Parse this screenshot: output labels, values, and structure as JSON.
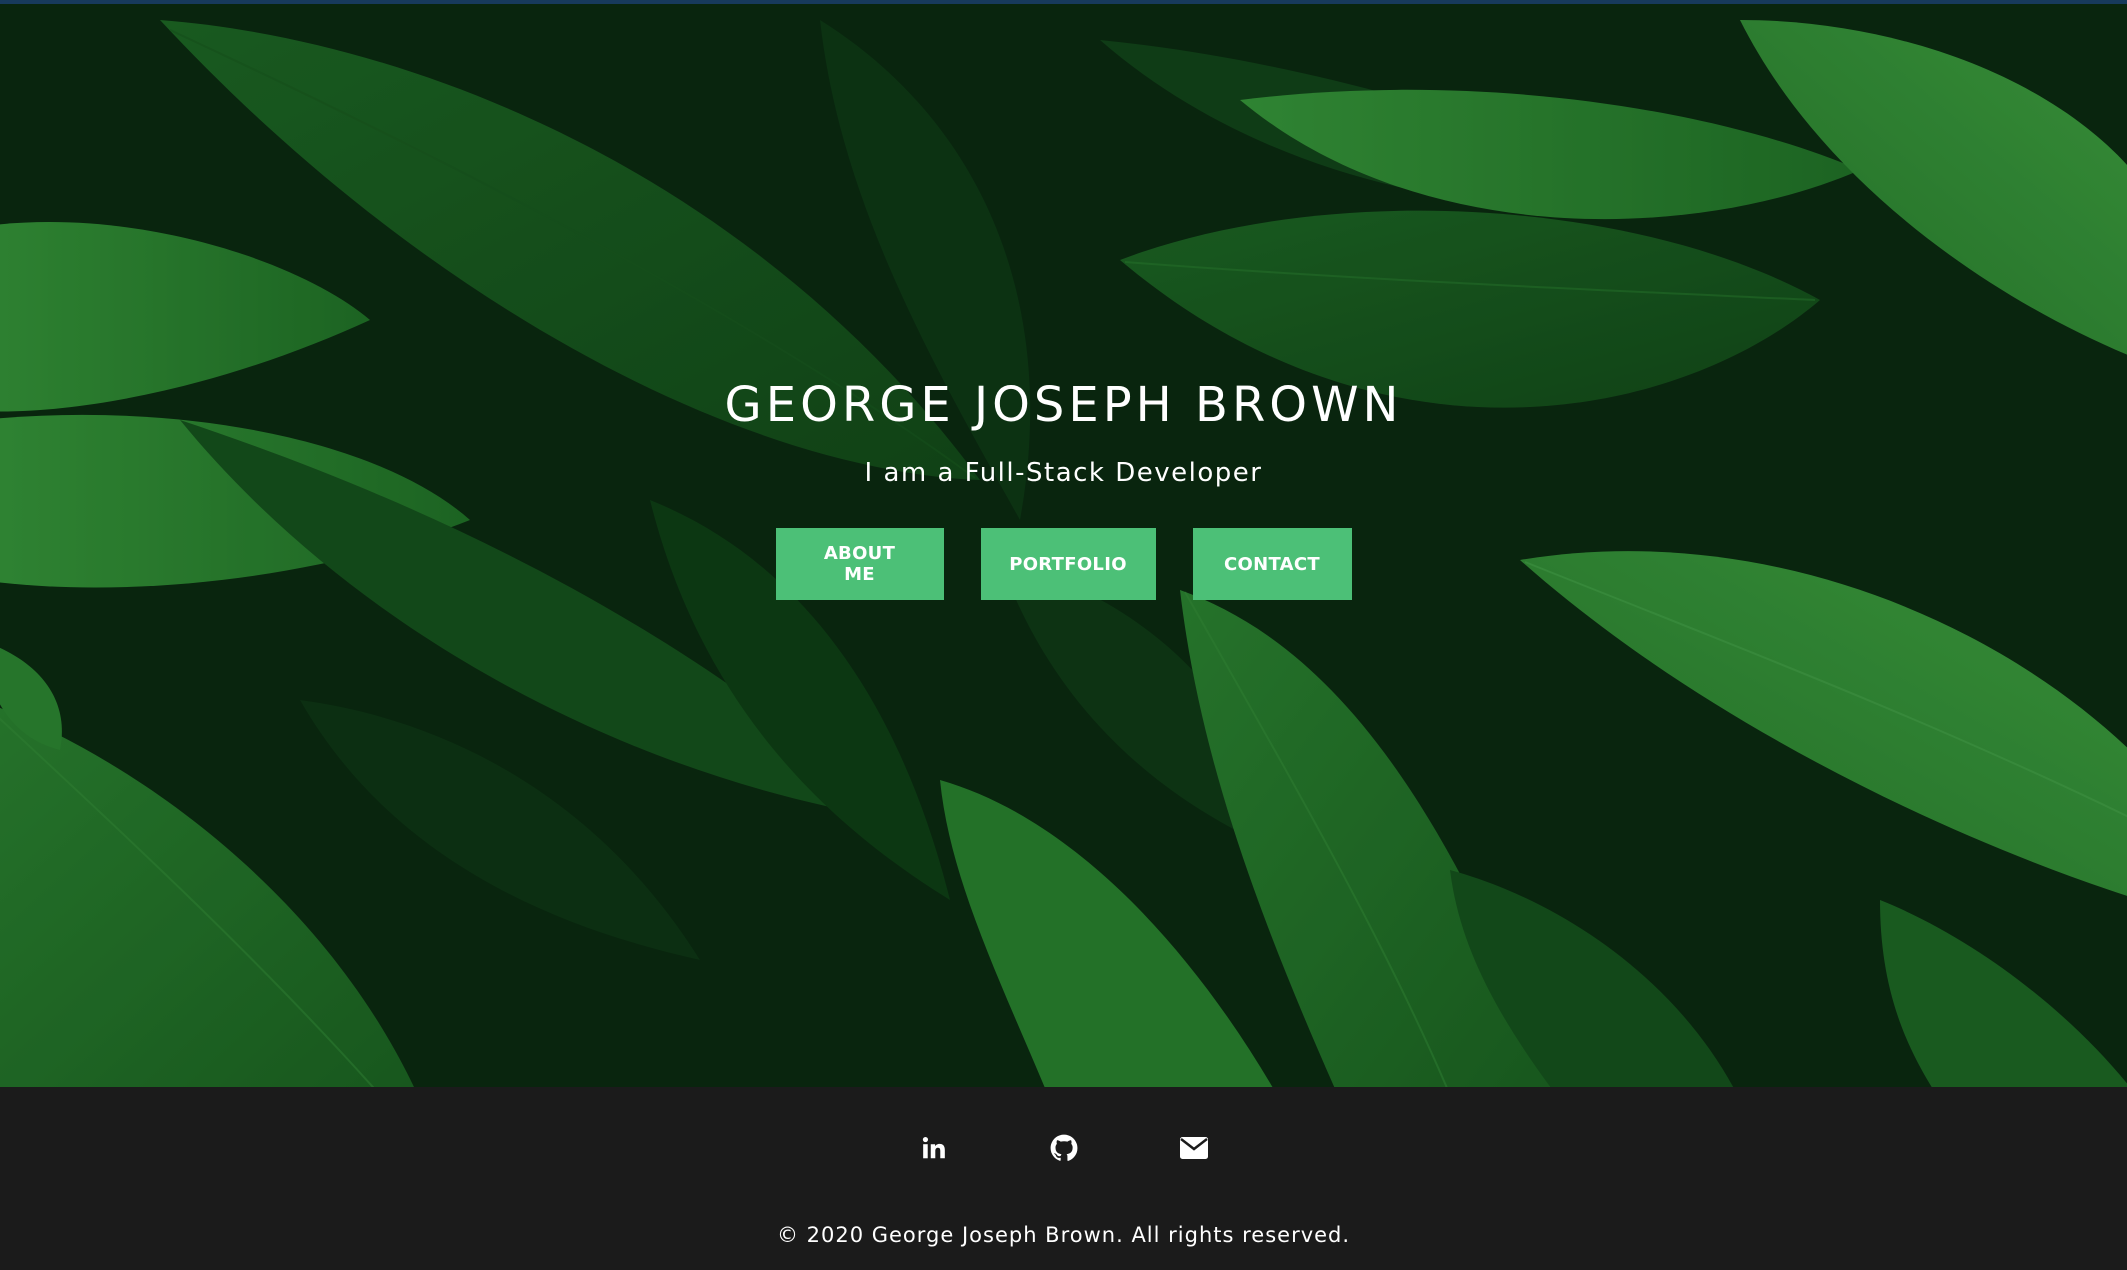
{
  "hero": {
    "title": "GEORGE JOSEPH BROWN",
    "subtitle": "I am a Full-Stack Developer",
    "buttons": [
      {
        "label": "ABOUT ME"
      },
      {
        "label": "PORTFOLIO"
      },
      {
        "label": "CONTACT"
      }
    ],
    "background": "green-leaves-photo"
  },
  "footer": {
    "icons": [
      {
        "name": "linkedin-icon"
      },
      {
        "name": "github-icon"
      },
      {
        "name": "envelope-icon"
      }
    ],
    "copyright": "© 2020 George Joseph Brown. All rights reserved."
  },
  "colors": {
    "accent": "#4cc077",
    "footer_bg": "#1b1b1b",
    "text": "#ffffff"
  }
}
